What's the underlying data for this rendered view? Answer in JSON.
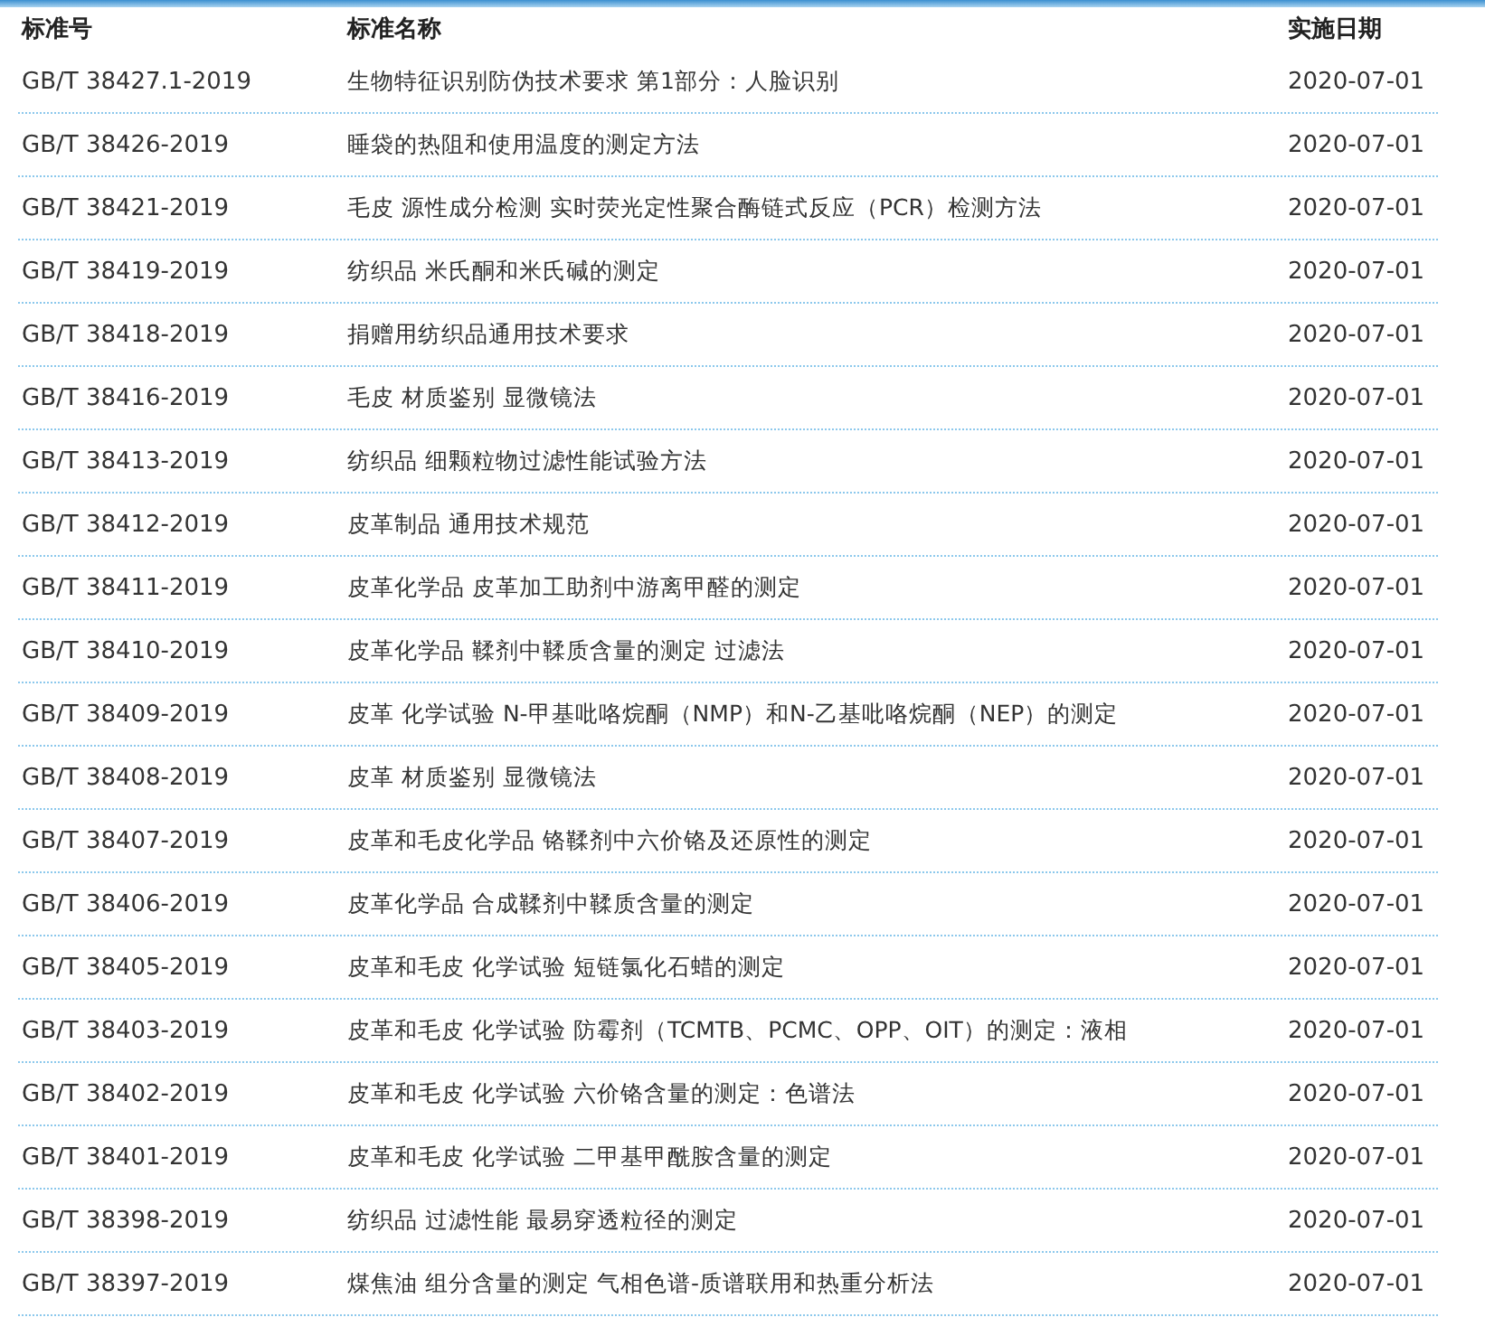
{
  "table": {
    "columns": [
      "标准号",
      "标准名称",
      "实施日期"
    ],
    "rows": [
      {
        "code": "GB/T 38427.1-2019",
        "name": "生物特征识别防伪技术要求 第1部分：人脸识别",
        "date": "2020-07-01"
      },
      {
        "code": "GB/T 38426-2019",
        "name": "睡袋的热阻和使用温度的测定方法",
        "date": "2020-07-01"
      },
      {
        "code": "GB/T 38421-2019",
        "name": "毛皮 源性成分检测 实时荧光定性聚合酶链式反应（PCR）检测方法",
        "date": "2020-07-01"
      },
      {
        "code": "GB/T 38419-2019",
        "name": "纺织品 米氏酮和米氏碱的测定",
        "date": "2020-07-01"
      },
      {
        "code": "GB/T 38418-2019",
        "name": "捐赠用纺织品通用技术要求",
        "date": "2020-07-01"
      },
      {
        "code": "GB/T 38416-2019",
        "name": "毛皮 材质鉴别 显微镜法",
        "date": "2020-07-01"
      },
      {
        "code": "GB/T 38413-2019",
        "name": "纺织品 细颗粒物过滤性能试验方法",
        "date": "2020-07-01"
      },
      {
        "code": "GB/T 38412-2019",
        "name": "皮革制品 通用技术规范",
        "date": "2020-07-01"
      },
      {
        "code": "GB/T 38411-2019",
        "name": "皮革化学品 皮革加工助剂中游离甲醛的测定",
        "date": "2020-07-01"
      },
      {
        "code": "GB/T 38410-2019",
        "name": "皮革化学品 鞣剂中鞣质含量的测定 过滤法",
        "date": "2020-07-01"
      },
      {
        "code": "GB/T 38409-2019",
        "name": "皮革 化学试验 N-甲基吡咯烷酮（NMP）和N-乙基吡咯烷酮（NEP）的测定",
        "date": "2020-07-01"
      },
      {
        "code": "GB/T 38408-2019",
        "name": "皮革 材质鉴别 显微镜法",
        "date": "2020-07-01"
      },
      {
        "code": "GB/T 38407-2019",
        "name": "皮革和毛皮化学品 铬鞣剂中六价铬及还原性的测定",
        "date": "2020-07-01"
      },
      {
        "code": "GB/T 38406-2019",
        "name": "皮革化学品 合成鞣剂中鞣质含量的测定",
        "date": "2020-07-01"
      },
      {
        "code": "GB/T 38405-2019",
        "name": "皮革和毛皮 化学试验 短链氯化石蜡的测定",
        "date": "2020-07-01"
      },
      {
        "code": "GB/T 38403-2019",
        "name": "皮革和毛皮 化学试验 防霉剂（TCMTB、PCMC、OPP、OIT）的测定：液相",
        "date": "2020-07-01"
      },
      {
        "code": "GB/T 38402-2019",
        "name": "皮革和毛皮 化学试验 六价铬含量的测定：色谱法",
        "date": "2020-07-01"
      },
      {
        "code": "GB/T 38401-2019",
        "name": "皮革和毛皮 化学试验 二甲基甲酰胺含量的测定",
        "date": "2020-07-01"
      },
      {
        "code": "GB/T 38398-2019",
        "name": "纺织品 过滤性能 最易穿透粒径的测定",
        "date": "2020-07-01"
      },
      {
        "code": "GB/T 38397-2019",
        "name": "煤焦油 组分含量的测定 气相色谱-质谱联用和热重分析法",
        "date": "2020-07-01"
      }
    ]
  }
}
